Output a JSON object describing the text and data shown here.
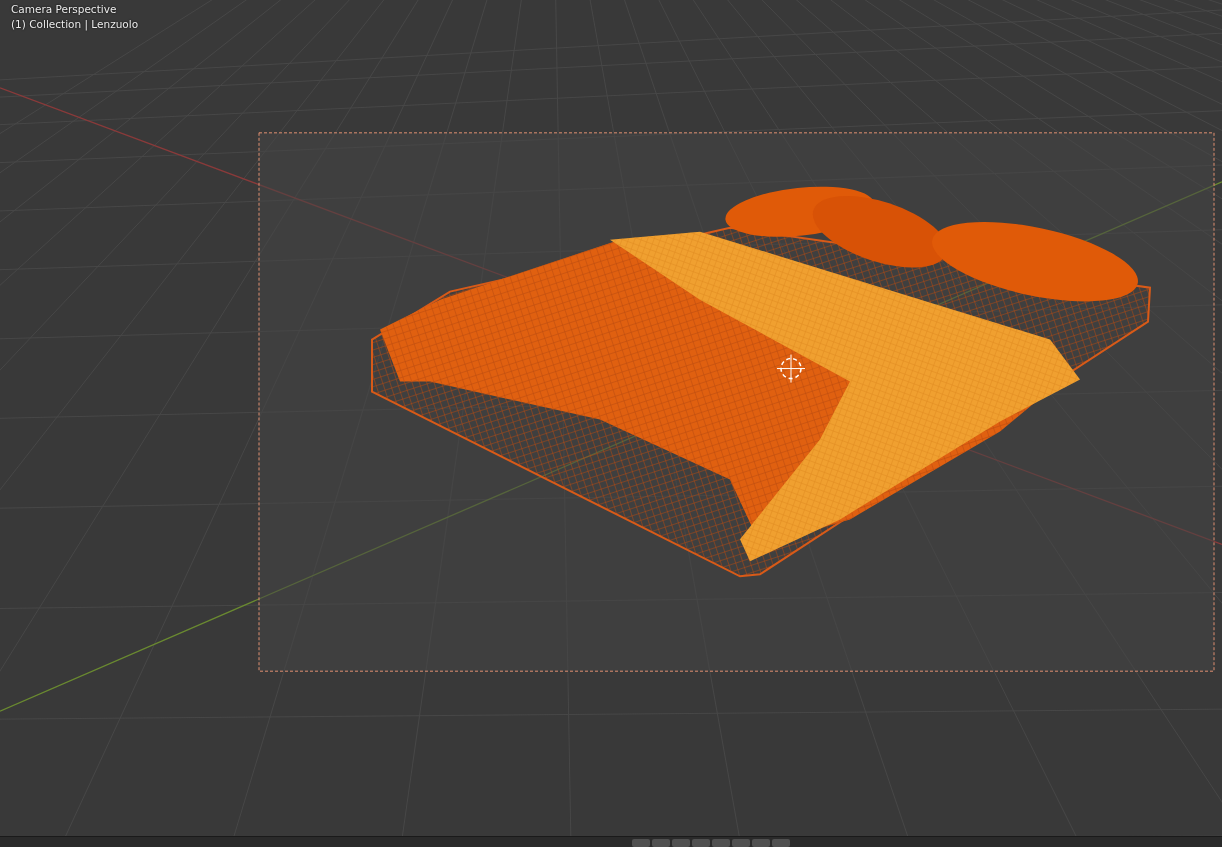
{
  "viewport": {
    "view_name": "Camera Perspective",
    "object_info": "(1) Collection | Lenzuolo"
  }
}
